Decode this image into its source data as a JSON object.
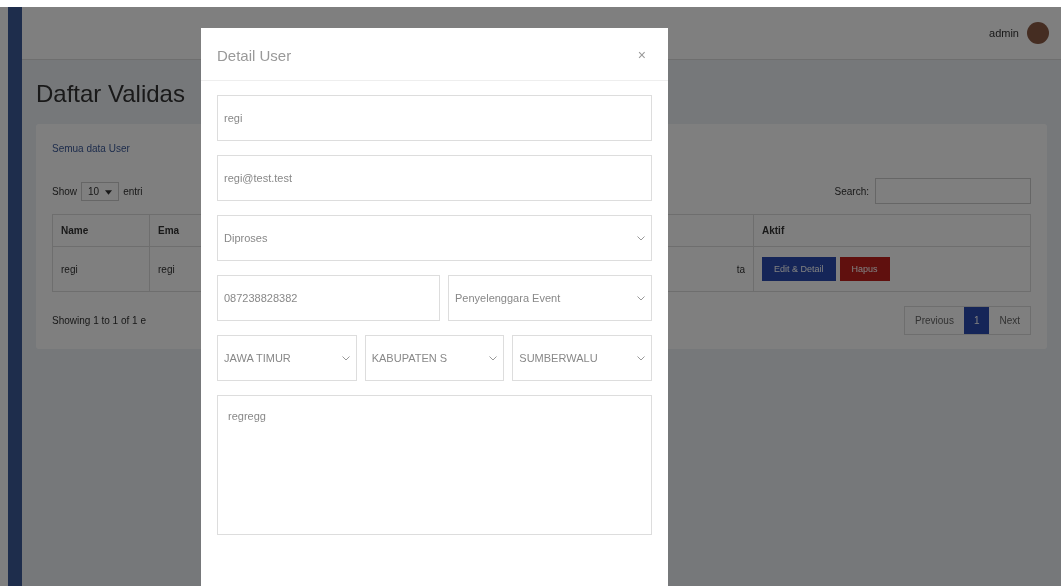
{
  "header": {
    "username": "admin"
  },
  "page": {
    "title": "Daftar Validas",
    "card_tab": "Semua data User",
    "show": {
      "label": "Show",
      "value": "10",
      "suffix": "entri"
    },
    "search": {
      "label": "Search:"
    },
    "table": {
      "columns": [
        {
          "label": "Name"
        },
        {
          "label": "Ema"
        }
      ],
      "action_label": "Aktif",
      "rows": [
        {
          "cells": [
            "regi",
            "regi",
            "ta"
          ],
          "actions": [
            {
              "label": "Edit & Detail",
              "kind": "primary"
            },
            {
              "label": "Hapus",
              "kind": "danger"
            }
          ]
        }
      ]
    },
    "info": "Showing 1 to 1 of 1 e",
    "pagination": [
      {
        "label": "Previous",
        "selected": false
      },
      {
        "label": "1",
        "selected": true
      },
      {
        "label": "Next",
        "selected": false
      }
    ]
  },
  "modal": {
    "title": "Detail User",
    "close": "×",
    "fields": [
      {
        "kind": "input",
        "value": "regi"
      },
      {
        "kind": "input",
        "value": "regi@test.test"
      },
      {
        "kind": "select",
        "value": "Diproses"
      }
    ],
    "row1": [
      {
        "kind": "input",
        "value": "087238828382"
      },
      {
        "kind": "select",
        "value": "Penyelenggara Event"
      }
    ],
    "row2": [
      {
        "kind": "select",
        "value": "JAWA TIMUR"
      },
      {
        "kind": "select",
        "value": "KABUPATEN S"
      },
      {
        "kind": "select",
        "value": "SUMBERWALU"
      }
    ],
    "address": "regregg"
  }
}
